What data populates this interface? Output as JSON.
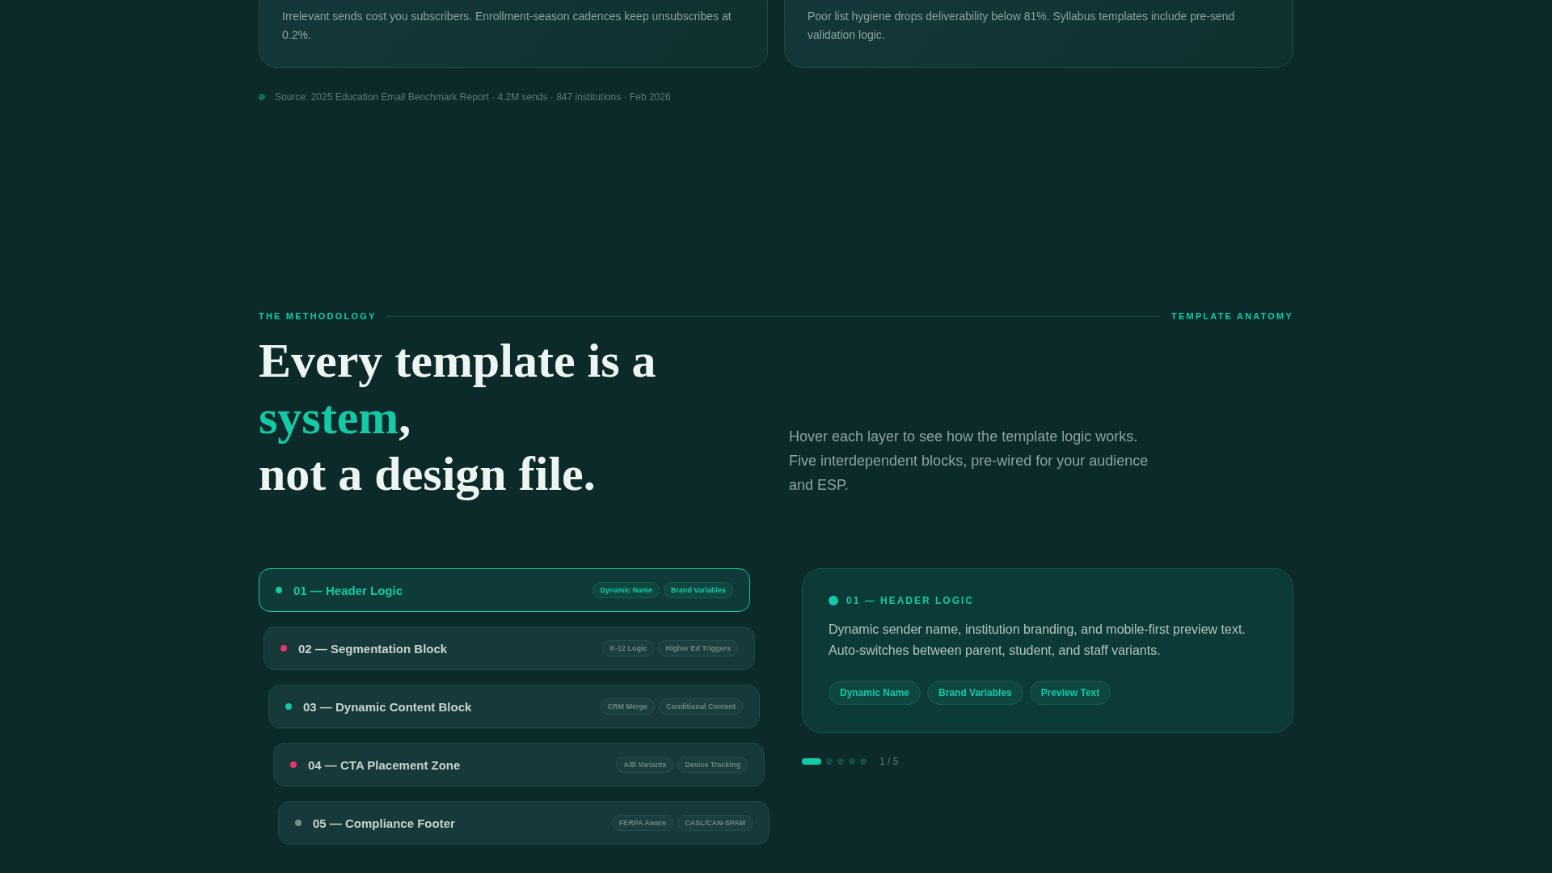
{
  "stat_cards": [
    {
      "text": "Irrelevant sends cost you subscribers. Enrollment-season cadences keep unsubscribes at 0.2%."
    },
    {
      "text": "Poor list hygiene drops deliverability below 81%. Syllabus templates include pre-send validation logic."
    }
  ],
  "source": {
    "text": "Source: 2025 Education Email Benchmark Report · 4.2M sends · 847 institutions · Feb 2026",
    "color": "#0f6b57"
  },
  "section": {
    "eyebrow": "THE METHODOLOGY",
    "eyebrow_right": "TEMPLATE ANATOMY"
  },
  "heading": {
    "line_1": "Every template is a",
    "accent": "system",
    "accent_suffix": ",",
    "line_3": "not a design file."
  },
  "intro": "Hover each layer to see how the template logic works. Five interdependent blocks, pre-wired for your audience and ESP.",
  "layers": [
    {
      "title": "01 — Header Logic",
      "color": "#14c9a6",
      "selected": true,
      "tags": [
        "Dynamic Name",
        "Brand Variables"
      ]
    },
    {
      "title": "02 — Segmentation Block",
      "color": "#e8336f",
      "selected": false,
      "tags": [
        "K-12 Logic",
        "Higher Ed Triggers"
      ]
    },
    {
      "title": "03 — Dynamic Content Block",
      "color": "#14c9a6",
      "selected": false,
      "tags": [
        "CRM Merge",
        "Conditional Content"
      ]
    },
    {
      "title": "04 — CTA Placement Zone",
      "color": "#e8336f",
      "selected": false,
      "tags": [
        "A/B Variants",
        "Device Tracking"
      ]
    },
    {
      "title": "05 — Compliance Footer",
      "color": "#7a8c8a",
      "selected": false,
      "tags": [
        "FERPA Aware",
        "CASL/CAN-SPAM"
      ]
    }
  ],
  "detail": {
    "title": "01 — HEADER LOGIC",
    "body": "Dynamic sender name, institution branding, and mobile-first preview text. Auto-switches between parent, student, and staff variants.",
    "tags": [
      "Dynamic Name",
      "Brand Variables",
      "Preview Text"
    ]
  },
  "pager": {
    "dots": [
      {
        "selected": true
      },
      {
        "selected": false
      },
      {
        "selected": false
      },
      {
        "selected": false
      },
      {
        "selected": false
      }
    ],
    "counter": "1 / 5"
  }
}
